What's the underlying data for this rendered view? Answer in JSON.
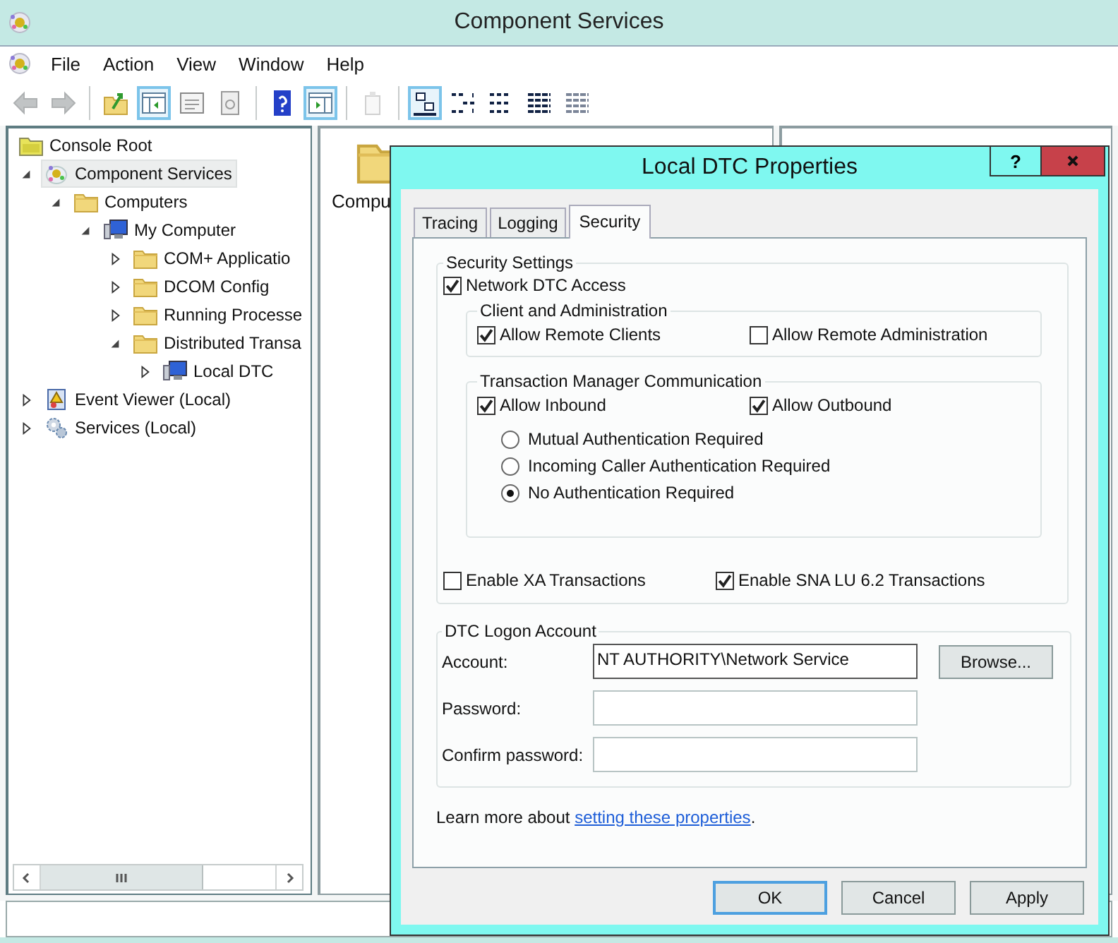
{
  "window": {
    "title": "Component Services"
  },
  "menu": [
    "File",
    "Action",
    "View",
    "Window",
    "Help"
  ],
  "toolbar": [
    {
      "kind": "back",
      "pressed": false,
      "disabled": true
    },
    {
      "kind": "forward",
      "pressed": false,
      "disabled": true
    },
    {
      "kind": "separator"
    },
    {
      "kind": "up",
      "pressed": false,
      "disabled": false
    },
    {
      "kind": "tree-pane",
      "pressed": true,
      "disabled": false
    },
    {
      "kind": "properties",
      "pressed": false,
      "disabled": false
    },
    {
      "kind": "export",
      "pressed": false,
      "disabled": false
    },
    {
      "kind": "separator"
    },
    {
      "kind": "help",
      "pressed": false,
      "disabled": false
    },
    {
      "kind": "action-pane",
      "pressed": true,
      "disabled": false
    },
    {
      "kind": "separator"
    },
    {
      "kind": "new-window",
      "pressed": false,
      "disabled": true
    },
    {
      "kind": "separator"
    },
    {
      "kind": "large-icons",
      "pressed": true,
      "disabled": false
    },
    {
      "kind": "small-icons",
      "pressed": false,
      "disabled": false
    },
    {
      "kind": "list",
      "pressed": false,
      "disabled": false
    },
    {
      "kind": "details",
      "pressed": false,
      "disabled": false
    },
    {
      "kind": "details",
      "pressed": false,
      "disabled": true
    }
  ],
  "tree": {
    "label": "Console Root",
    "kind": "root",
    "selected": false,
    "children": [
      {
        "label": "Component Services",
        "kind": "component",
        "expanded": true,
        "selected": true,
        "children": [
          {
            "label": "Computers",
            "kind": "folder",
            "expanded": true,
            "selected": false,
            "children": [
              {
                "label": "My Computer",
                "kind": "computer",
                "expanded": true,
                "selected": false,
                "children": [
                  {
                    "label": "COM+ Applicatio",
                    "kind": "folder",
                    "expanded": false,
                    "selected": false
                  },
                  {
                    "label": "DCOM Config",
                    "kind": "folder",
                    "expanded": false,
                    "selected": false
                  },
                  {
                    "label": "Running Processe",
                    "kind": "folder",
                    "expanded": false,
                    "selected": false
                  },
                  {
                    "label": "Distributed Transa",
                    "kind": "folder",
                    "expanded": true,
                    "selected": false,
                    "children": [
                      {
                        "label": "Local DTC",
                        "kind": "computer",
                        "expanded": false,
                        "selected": false
                      }
                    ]
                  }
                ]
              }
            ]
          }
        ]
      },
      {
        "label": "Event Viewer (Local)",
        "kind": "event-log",
        "expanded": false,
        "selected": false
      },
      {
        "label": "Services (Local)",
        "kind": "services",
        "expanded": false,
        "selected": false
      }
    ]
  },
  "content_pane": {
    "items": [
      {
        "label": "Compu",
        "kind": "folder"
      }
    ]
  },
  "dialog": {
    "title": "Local DTC Properties",
    "help_label": "?",
    "tabs": [
      {
        "label": "Tracing",
        "selected": false
      },
      {
        "label": "Logging",
        "selected": false
      },
      {
        "label": "Security",
        "selected": true
      }
    ],
    "security_settings": {
      "legend": "Security Settings",
      "network_access": {
        "label": "Network DTC Access",
        "checked": true
      },
      "client_admin": {
        "legend": "Client and Administration",
        "options": [
          {
            "label": "Allow Remote Clients",
            "checked": true
          },
          {
            "label": "Allow Remote Administration",
            "checked": false
          }
        ]
      },
      "tm_communication": {
        "legend": "Transaction Manager Communication",
        "options": [
          {
            "label": "Allow Inbound",
            "checked": true
          },
          {
            "label": "Allow Outbound",
            "checked": true
          }
        ],
        "authentication": [
          {
            "label": "Mutual Authentication Required",
            "selected": false
          },
          {
            "label": "Incoming Caller Authentication Required",
            "selected": false
          },
          {
            "label": "No Authentication Required",
            "selected": true
          }
        ]
      },
      "options": [
        {
          "label": "Enable XA Transactions",
          "checked": false
        },
        {
          "label": "Enable SNA LU 6.2 Transactions",
          "checked": true
        }
      ]
    },
    "logon_account": {
      "legend": "DTC Logon Account",
      "fields": [
        {
          "label": "Account:",
          "value": "NT AUTHORITY\\Network Service"
        },
        {
          "label": "Password:"
        },
        {
          "label": "Confirm password:"
        }
      ],
      "browse_button": "Browse..."
    },
    "learn_more": {
      "text": "Learn more about ",
      "link": "setting these properties",
      "after": "."
    },
    "buttons": [
      {
        "label": "OK",
        "default": true
      },
      {
        "label": "Cancel",
        "default": false
      },
      {
        "label": "Apply",
        "default": false
      }
    ]
  }
}
